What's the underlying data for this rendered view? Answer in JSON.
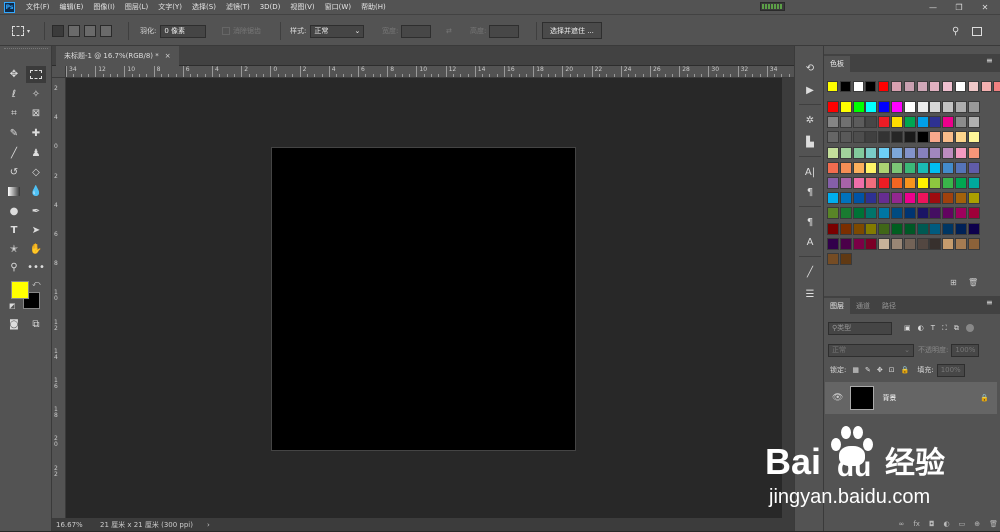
{
  "menubar": {
    "logo": "Ps",
    "items": [
      "文件(F)",
      "编辑(E)",
      "图像(I)",
      "图层(L)",
      "文字(Y)",
      "选择(S)",
      "滤镜(T)",
      "3D(D)",
      "视图(V)",
      "窗口(W)",
      "帮助(H)"
    ],
    "min": "—",
    "max": "❐",
    "close": "✕"
  },
  "options": {
    "feather_label": "羽化:",
    "feather_value": "0 像素",
    "antialias_label": "消除锯齿",
    "style_label": "样式:",
    "style_value": "正常",
    "width_label": "宽度:",
    "height_label": "高度:",
    "select_mask_button": "选择并遮住 ..."
  },
  "document": {
    "tab_title": "未标题-1 @ 16.7%(RGB/8) *",
    "tab_close": "×",
    "ruler_h_labels": [
      "34",
      "12",
      "10",
      "8",
      "6",
      "4",
      "2",
      "0",
      "2",
      "4",
      "6",
      "8",
      "10",
      "12",
      "14",
      "16",
      "18",
      "20",
      "22",
      "24",
      "26",
      "28",
      "30",
      "32",
      "34"
    ],
    "ruler_v_labels": [
      "2",
      "4",
      "0",
      "2",
      "4",
      "6",
      "8",
      "1\n0",
      "1\n2",
      "1\n4",
      "1\n6",
      "1\n8",
      "2\n0",
      "2\n2"
    ]
  },
  "status": {
    "zoom": "16.67%",
    "doc_size": "21 厘米 x 21 厘米 (300 ppi)",
    "arrow": "›"
  },
  "colors": {
    "foreground": "#ffff00",
    "background": "#000000"
  },
  "swatches_panel": {
    "tab": "色板",
    "recent": [
      "#ffff00",
      "#000000",
      "#ffffff",
      "#000000",
      "#ff0000",
      "#d8a0b0",
      "#c8a0b0",
      "#d0a8b8",
      "#e0b0c0",
      "#f0c0d0",
      "#ffffff",
      "#f0c8c8",
      "#f4b0b0",
      "#f08080"
    ],
    "grid": [
      [
        "#ff0000",
        "#ffff00",
        "#00ff00",
        "#00ffff",
        "#0000ff",
        "#ff00ff",
        "#ffffff",
        "#ebebeb",
        "#d6d6d6",
        "#c2c2c2",
        "#adadad",
        "#999999"
      ],
      [
        "#858585",
        "#707070",
        "#5c5c5c",
        "#474747",
        "#ec1c24",
        "#ffdd00",
        "#00a651",
        "#00a0e9",
        "#2e3192",
        "#ec008c",
        "#8c8c8c",
        "#b0b0b0"
      ],
      [
        "#666666",
        "#595959",
        "#4d4d4d",
        "#404040",
        "#333333",
        "#262626",
        "#1a1a1a",
        "#000000",
        "#f8a88c",
        "#f9bc8a",
        "#fdd58c",
        "#fff799"
      ],
      [
        "#c4df9b",
        "#a2d39c",
        "#82ca9c",
        "#7accc8",
        "#6dcff6",
        "#7da7d9",
        "#8393ca",
        "#8781bd",
        "#a187be",
        "#bd8cbf",
        "#f49ac1",
        "#f69679"
      ],
      [
        "#f26c4f",
        "#f68e55",
        "#fbaf5c",
        "#fff467",
        "#acd372",
        "#7cc576",
        "#3bb878",
        "#1abbb4",
        "#00bff3",
        "#438ccb",
        "#5574b9",
        "#605ca8"
      ],
      [
        "#855fa8",
        "#a763a8",
        "#f06ea9",
        "#f26d7d",
        "#ed1c24",
        "#f26522",
        "#f7941d",
        "#fff200",
        "#8dc63f",
        "#39b54a",
        "#00a651",
        "#00a99d"
      ],
      [
        "#00aeef",
        "#0072bc",
        "#0054a6",
        "#2e3192",
        "#662d91",
        "#92278f",
        "#ec008c",
        "#ed145b",
        "#9e0b0f",
        "#a0410d",
        "#a3620a",
        "#aba000"
      ],
      [
        "#598527",
        "#197b30",
        "#007236",
        "#00746b",
        "#0076a3",
        "#004b80",
        "#003471",
        "#1b1464",
        "#440e62",
        "#630460",
        "#9e005d",
        "#9e0039"
      ],
      [
        "#790000",
        "#7b2e00",
        "#7d4900",
        "#827b00",
        "#406618",
        "#005e20",
        "#005826",
        "#005952",
        "#005b7f",
        "#003663",
        "#002157",
        "#0d004c"
      ],
      [
        "#32004b",
        "#4b0049",
        "#7b0046",
        "#7a0026",
        "#c7b299",
        "#998675",
        "#736357",
        "#534741",
        "#37302d",
        "#c69c6d",
        "#a67c52",
        "#8c6239"
      ],
      [
        "#754c24",
        "#603913"
      ]
    ]
  },
  "layers_panel": {
    "tabs": [
      "图层",
      "通道",
      "路径"
    ],
    "filter_kind": "类型",
    "blend_mode": "正常",
    "opacity_label": "不透明度:",
    "opacity_value": "100%",
    "lock_label": "锁定:",
    "fill_label": "填充:",
    "fill_value": "100%",
    "layer_name": "背景",
    "bottom_icons": [
      "∞",
      "fx",
      "◘",
      "◐",
      "▭",
      "⊕",
      "🗑"
    ]
  },
  "watermark": {
    "brand": "Bai",
    "brand2": "du",
    "cn": "经验",
    "url": "jingyan.baidu.com"
  }
}
